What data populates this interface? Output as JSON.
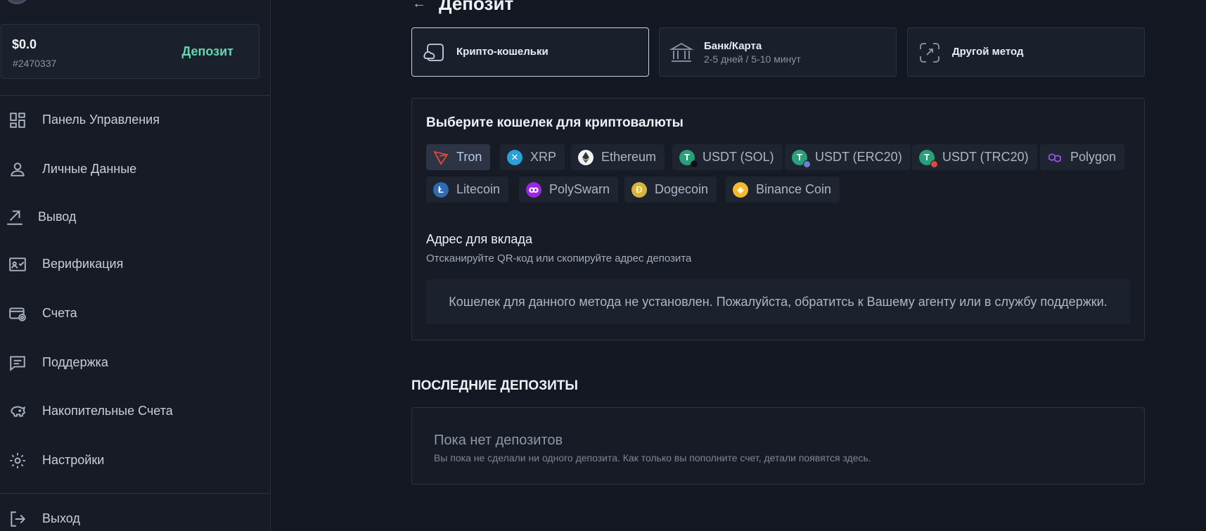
{
  "sidebar": {
    "balance": {
      "amount": "$0.0",
      "id": "#2470337",
      "deposit_label": "Депозит"
    },
    "items": [
      {
        "label": "Панель Управления",
        "icon": "dashboard-icon"
      },
      {
        "label": "Личные Данные",
        "icon": "user-icon"
      },
      {
        "label": "Вывод",
        "icon": "withdraw-icon"
      },
      {
        "label": "Верификация",
        "icon": "verification-icon"
      },
      {
        "label": "Счета",
        "icon": "accounts-icon"
      },
      {
        "label": "Поддержка",
        "icon": "support-icon"
      },
      {
        "label": "Накопительные Счета",
        "icon": "piggy-bank-icon"
      },
      {
        "label": "Настройки",
        "icon": "gear-icon"
      }
    ],
    "logout_label": "Выход"
  },
  "main": {
    "title": "Депозит",
    "methods": [
      {
        "name": "Крипто-кошельки",
        "sub": "",
        "icon": "crypto-wallet-icon",
        "active": true
      },
      {
        "name": "Банк/Карта",
        "sub": "2-5 дней / 5-10 минут",
        "icon": "bank-icon",
        "active": false
      },
      {
        "name": "Другой метод",
        "sub": "",
        "icon": "other-method-icon",
        "active": false
      }
    ],
    "wallet_panel": {
      "title": "Выберите кошелек для криптовалюты",
      "coins": [
        {
          "label": "Tron",
          "icon": "tron-icon",
          "selected": true
        },
        {
          "label": "XRP",
          "icon": "xrp-icon"
        },
        {
          "label": "Ethereum",
          "icon": "ethereum-icon"
        },
        {
          "label": "USDT (SOL)",
          "icon": "usdt-sol-icon"
        },
        {
          "label": "USDT (ERC20)",
          "icon": "usdt-erc20-icon"
        },
        {
          "label": "USDT (TRC20)",
          "icon": "usdt-trc20-icon"
        },
        {
          "label": "Polygon",
          "icon": "polygon-icon"
        },
        {
          "label": "Litecoin",
          "icon": "litecoin-icon"
        },
        {
          "label": "PolySwarn",
          "icon": "polyswarm-icon"
        },
        {
          "label": "Dogecoin",
          "icon": "dogecoin-icon"
        },
        {
          "label": "Binance Coin",
          "icon": "binance-coin-icon"
        }
      ],
      "address_title": "Адрес для вклада",
      "address_sub": "Отсканируйте QR-код или скопируйте адрес депозита",
      "notice": "Кошелек для данного метода не установлен. Пожалуйста, обратитсь к Вашему агенту или в службу поддержки."
    },
    "recent": {
      "title": "ПОСЛЕДНИЕ ДЕПОЗИТЫ",
      "empty_title": "Пока нет депозитов",
      "empty_sub": "Вы пока не сделали ни одного депозита. Как только вы пополните счет, детали появятся здесь."
    }
  },
  "colors": {
    "background": "#131823",
    "accent_green": "#5fd6b4",
    "active_border": "#c7d0e0"
  }
}
